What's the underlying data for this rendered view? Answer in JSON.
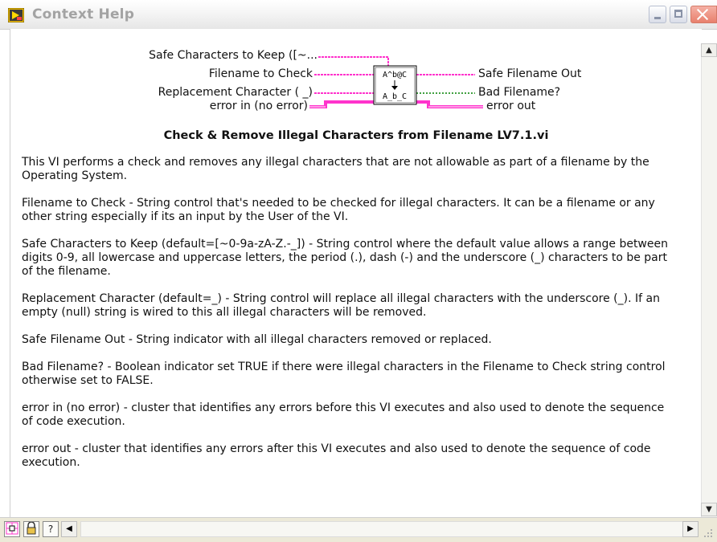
{
  "window": {
    "title": "Context Help"
  },
  "connector": {
    "inputs": [
      "Safe Characters to Keep ([~...",
      "Filename to Check",
      "Replacement Character ( _)",
      "error in (no error)"
    ],
    "outputs": [
      "Safe Filename Out",
      "Bad Filename?",
      "error out"
    ],
    "icon_top": "A^b@C",
    "icon_bottom": "A_b_C"
  },
  "vi_name": "Check & Remove Illegal Characters from Filename LV7.1.vi",
  "paragraphs": [
    "This VI performs a check and removes any illegal characters that are not allowable as part of a filename by the Operating System.",
    "Filename to Check - String control that's needed to be checked for illegal characters. It can be a filename or any other string especially if its an input by the User of the VI.",
    "Safe Characters to Keep (default=[~0-9a-zA-Z.-_]) - String control where the default value allows a range between digits 0-9, all lowercase and uppercase letters, the period (.), dash (-) and the underscore (_) characters to be part of the filename.",
    "Replacement Character (default=_) - String control will replace all illegal characters with the underscore (_). If an empty (null) string is wired to this all illegal characters will be removed.",
    "Safe Filename Out - String indicator with all illegal characters removed or replaced.",
    "Bad Filename? - Boolean indicator set TRUE if there were illegal characters in the Filename to Check string control otherwise set to FALSE.",
    "error in (no error) - cluster that identifies any errors before this VI executes and also used to denote the sequence of code execution.",
    "error out - cluster that identifies any errors after this VI executes and also used to denote the sequence of code execution."
  ],
  "bottom_buttons": {
    "hierarchy_label": "",
    "lock_label": "",
    "help_label": "?"
  },
  "colors": {
    "wire_string": "#ff33cc",
    "wire_boolean": "#008000",
    "wire_error": "#ff33cc"
  },
  "icons": {
    "app": "labview-context-help-icon",
    "scroll_up": "chevron-up-icon",
    "scroll_down": "chevron-down-icon",
    "scroll_left": "chevron-left-icon",
    "scroll_right": "chevron-right-icon"
  }
}
